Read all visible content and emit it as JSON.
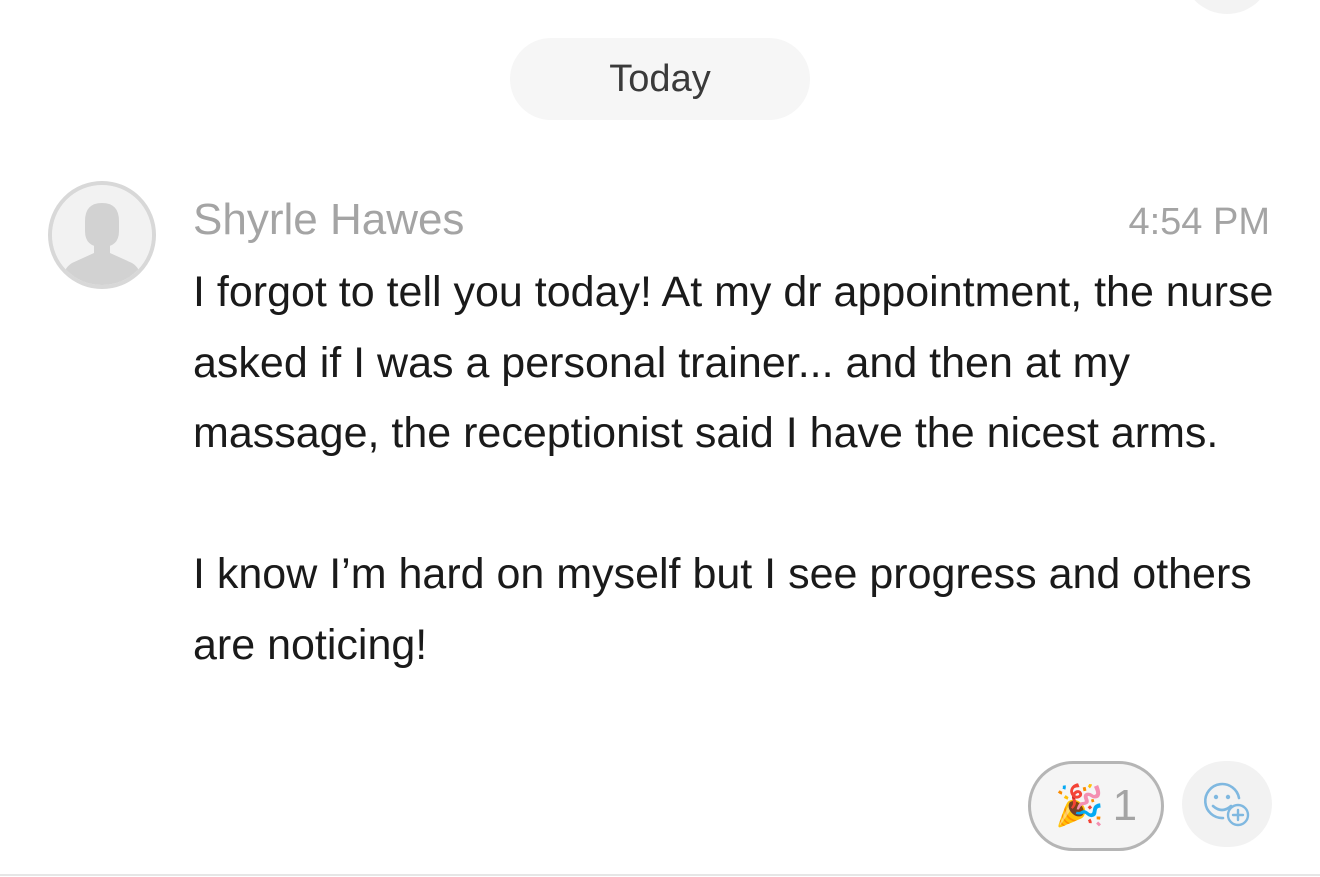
{
  "date_separator": {
    "label": "Today"
  },
  "message": {
    "sender": "Shyrle Hawes",
    "time": "4:54 PM",
    "paragraphs": [
      "I forgot to tell you today! At my dr appointment, the nurse asked if I was a personal trainer... and then at my massage, the receptionist said I have the nicest arms.",
      "I know I’m hard on myself but I see progress and others are noticing!"
    ],
    "avatar_icon": "default-user-avatar-icon"
  },
  "reactions": [
    {
      "emoji": "🎉",
      "icon": "party-popper-icon",
      "count": "1"
    }
  ],
  "add_reaction_icon": "add-emoji-reaction-icon",
  "colors": {
    "muted_text": "#a4a4a4",
    "body_text": "#1a1a1a",
    "pill_background": "#f6f6f6",
    "accent_icon": "#7fb8e0"
  }
}
